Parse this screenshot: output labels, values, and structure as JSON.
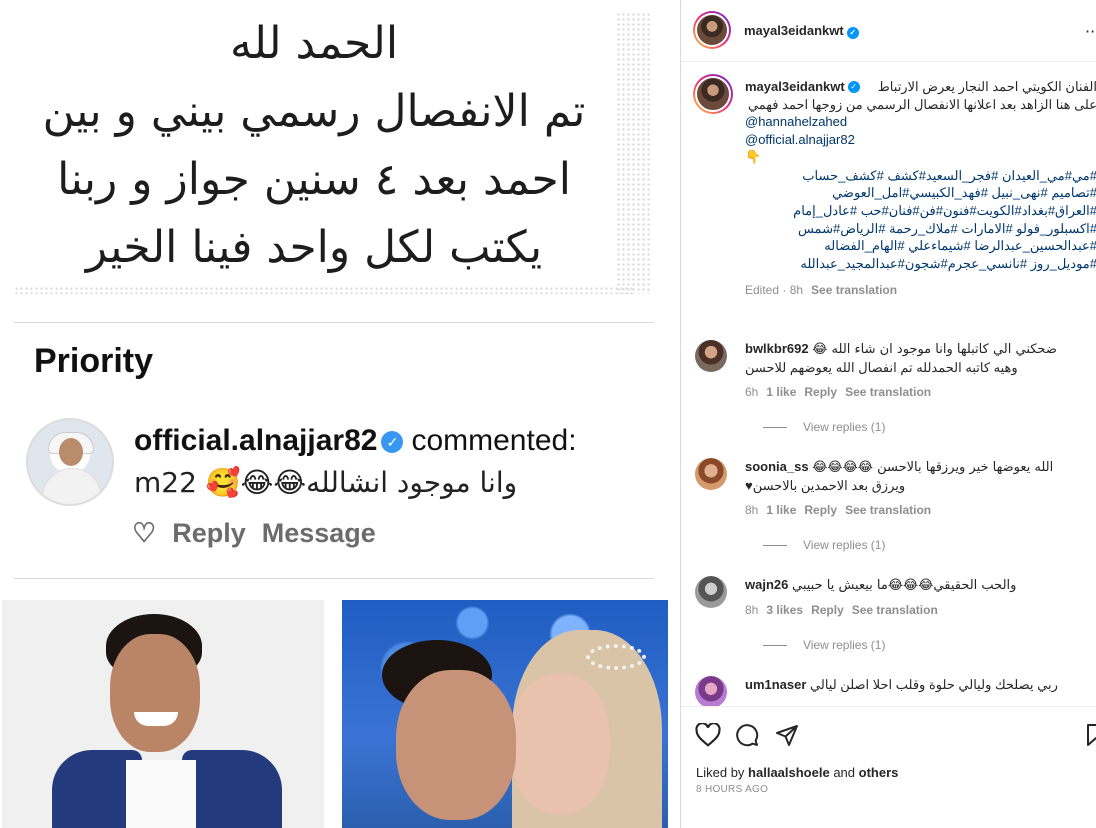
{
  "post_image": {
    "note_lines": [
      "الحمد لله",
      "تم الانفصال رسمي بيني و بين",
      "احمد بعد ٤ سنين جواز و ربنا",
      "يكتب لكل واحد فينا الخير"
    ],
    "priority_label": "Priority",
    "commenter_username": "official.alnajjar82",
    "commenter_suffix": "commented:",
    "comment_text": "m‏وانا موجود انشالله😂😂🥰 22",
    "comment_reply": "Reply",
    "comment_message": "Message"
  },
  "header": {
    "username": "mayal3eidankwt",
    "more": "···"
  },
  "caption": {
    "username": "mayal3eidankwt",
    "text": "الفنان الكويتي احمد النجار يعرض الارتباط على هنا الزاهد بعد اعلانها الانفصال الرسمي من زوجها احمد فهمي",
    "mention1": "@hannahelzahed",
    "mention2": "@official.alnajjar82",
    "pointer": "👇",
    "hashtags": [
      "#مي#مي_العيدان #فجر_السعيد#كشف #كشف_حساب",
      "#تصاميم #نهى_نبيل #فهد_الكبيسي#امل_العوضي",
      "#العراق#بغداد#الكويت#فنون#فن#فنان#حب #عادل_إمام",
      "#اكسبلور_فولو #الامارات #ملاك_رحمة #الرياض#شمس",
      "#عبدالحسين_عبدالرضا #شيماءعلي #الهام_الفضاله",
      "#موديل_روز #نانسي_عجرم#شجون#عبدالمجيد_عبدالله"
    ],
    "edited": "Edited · 8h",
    "see_translation": "See translation"
  },
  "comments": [
    {
      "username": "bwlkbr692",
      "text": "ضحكني الي كاتبلها وانا موجود ان شاء الله 😂",
      "text2": "وهيه كاتبه الحمدلله تم انفصال الله يعوضهم للاحسن",
      "time": "6h",
      "likes": "1 like",
      "reply": "Reply",
      "see_translation": "See translation",
      "view_replies": "View replies (1)"
    },
    {
      "username": "soonia_ss",
      "text": "الله يعوضها خير ويرزقها بالاحسن 😂😂😂😂",
      "text2": "ويرزق بعد الاحمدين بالاحسن♥",
      "time": "8h",
      "likes": "1 like",
      "reply": "Reply",
      "see_translation": "See translation",
      "view_replies": "View replies (1)"
    },
    {
      "username": "wajn26",
      "text": "والحب الحقيقي😂😂😂ما بيعيش يا حبيبي",
      "time": "8h",
      "likes": "3 likes",
      "reply": "Reply",
      "see_translation": "See translation",
      "view_replies": "View replies (1)"
    },
    {
      "username": "um1naser",
      "text": "ربي يصلحك وليالي حلوة وقلب احلا اصلن ليالي"
    }
  ],
  "footer": {
    "liked_by_prefix": "Liked by",
    "liked_by_user": "hallaalshoele",
    "liked_by_and": "and",
    "liked_by_others": "others",
    "date": "8 HOURS AGO"
  },
  "colors": {
    "link": "#00376b",
    "verified": "#0095f6",
    "muted": "#8e8e8e"
  }
}
